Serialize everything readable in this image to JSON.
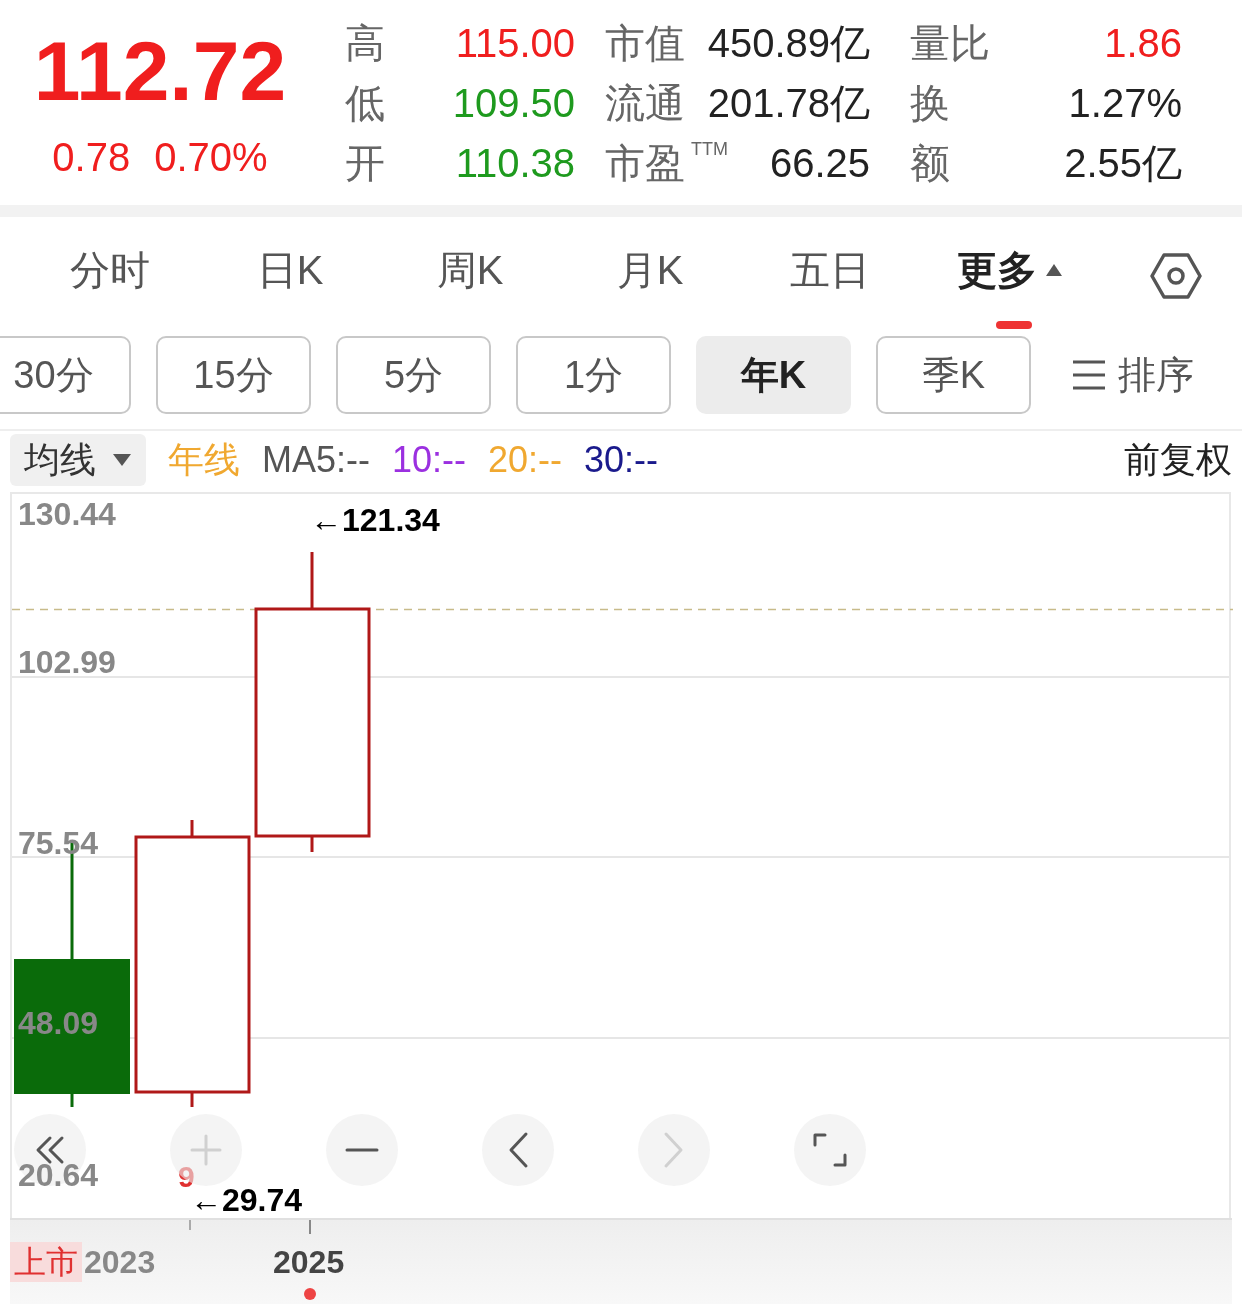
{
  "quote": {
    "price": "112.72",
    "change": "0.78",
    "change_pct": "0.70%",
    "color": "#f01e1e"
  },
  "stats": [
    {
      "label": "高",
      "value": "115.00",
      "color": "#f01e1e"
    },
    {
      "label": "市值",
      "value": "450.89亿",
      "color": "#222222"
    },
    {
      "label": "量比",
      "value": "1.86",
      "color": "#f01e1e"
    },
    {
      "label": "低",
      "value": "109.50",
      "color": "#1e9a1e"
    },
    {
      "label": "流通",
      "value": "201.78亿",
      "color": "#222222"
    },
    {
      "label": "换",
      "value": "1.27%",
      "color": "#222222"
    },
    {
      "label": "开",
      "value": "110.38",
      "color": "#1e9a1e"
    },
    {
      "label": "市盈",
      "sup": "TTM",
      "value": "66.25",
      "color": "#222222"
    },
    {
      "label": "额",
      "value": "2.55亿",
      "color": "#222222"
    }
  ],
  "tabs": [
    {
      "label": "分时",
      "selected": false
    },
    {
      "label": "日K",
      "selected": false
    },
    {
      "label": "周K",
      "selected": false
    },
    {
      "label": "月K",
      "selected": false
    },
    {
      "label": "五日",
      "selected": false
    },
    {
      "label": "更多",
      "selected": true
    }
  ],
  "periods": [
    {
      "label": "30分",
      "selected": false
    },
    {
      "label": "15分",
      "selected": false
    },
    {
      "label": "5分",
      "selected": false
    },
    {
      "label": "1分",
      "selected": false
    },
    {
      "label": "年K",
      "selected": true
    },
    {
      "label": "季K",
      "selected": false
    }
  ],
  "sort_label": "排序",
  "ma_bar": {
    "dropdown": "均线",
    "items": [
      {
        "text": "年线",
        "color": "#f0a830"
      },
      {
        "text": "MA5:--",
        "color": "#555555"
      },
      {
        "text": "10:--",
        "color": "#9b30e0"
      },
      {
        "text": "20:--",
        "color": "#f0a830"
      },
      {
        "text": "30:--",
        "color": "#1a1a8c"
      }
    ],
    "adjust": "前复权"
  },
  "chart": {
    "y_labels": [
      "130.44",
      "102.99",
      "75.54",
      "48.09",
      "20.64"
    ],
    "high_marker": "←121.34",
    "low_marker": "←29.74",
    "event_marker": "9",
    "listing_tag": "上市",
    "x_labels": [
      "2023",
      "2025"
    ]
  },
  "controls": [
    {
      "kind": "rewind",
      "disabled": false
    },
    {
      "kind": "zoom-in",
      "disabled": true
    },
    {
      "kind": "zoom-out",
      "disabled": false
    },
    {
      "kind": "left",
      "disabled": false
    },
    {
      "kind": "right",
      "disabled": true
    },
    {
      "kind": "fullscreen",
      "disabled": false
    }
  ]
}
